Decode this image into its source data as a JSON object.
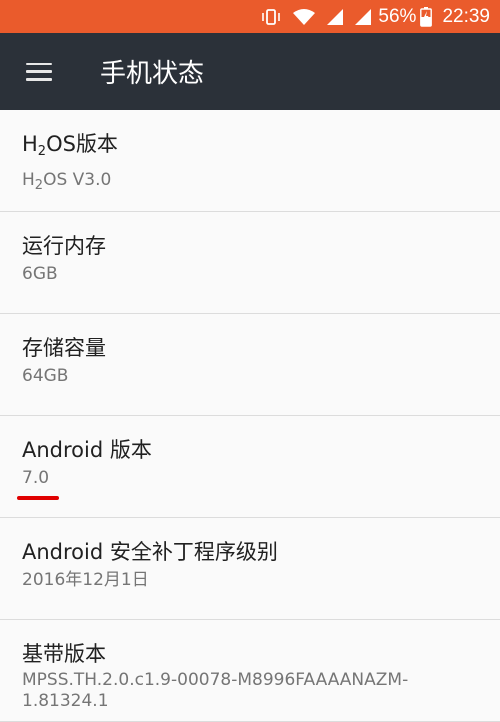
{
  "status_bar": {
    "battery_percent": "56%",
    "time": "22:39",
    "background": "#ea5b2c",
    "icons": [
      "vibrate-icon",
      "wifi-icon",
      "signal-icon",
      "signal-icon",
      "battery-charging-icon"
    ]
  },
  "app_bar": {
    "title": "手机状态",
    "menu_icon": "menu-icon",
    "background": "#2b3139"
  },
  "items": [
    {
      "title_pre": "H",
      "title_sub": "2",
      "title_post": "OS版本",
      "value_pre": "H",
      "value_sub": "2",
      "value_post": "OS V3.0"
    },
    {
      "title": "运行内存",
      "value": "6GB"
    },
    {
      "title": "存储容量",
      "value": "64GB"
    },
    {
      "title": "Android 版本",
      "value": "7.0"
    },
    {
      "title": "Android 安全补丁程序级别",
      "value": "2016年12月1日"
    },
    {
      "title": "基带版本",
      "value": "MPSS.TH.2.0.c1.9-00078-M8996FAAAANAZM-1.81324.1"
    }
  ],
  "annotation_color": "#e00000"
}
